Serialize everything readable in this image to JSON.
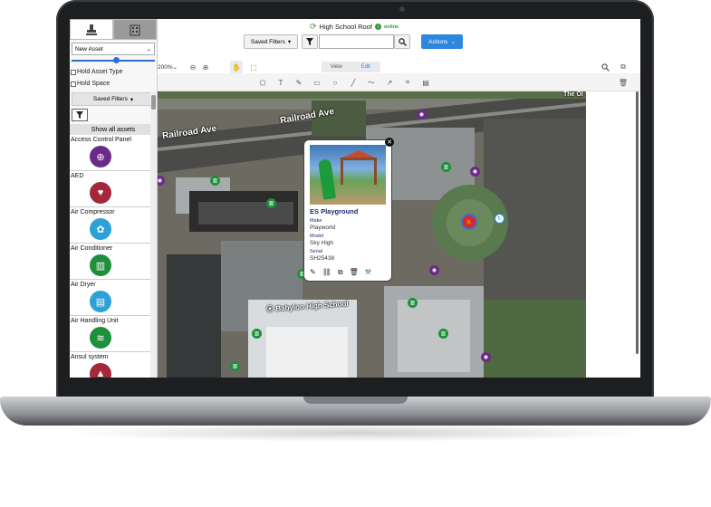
{
  "header": {
    "site_name": "High School Roof",
    "status": "online",
    "saved_filters_label": "Saved Filters",
    "actions_label": "Actions",
    "search_value": ""
  },
  "left_panel": {
    "new_asset_select": "New Asset",
    "hold_asset_type_label": "Hold Asset Type",
    "hold_space_label": "Hold Space",
    "saved_filters_label": "Saved Filters",
    "show_all_label": "Show all assets",
    "assets": [
      {
        "label": "Access Control Panel",
        "icon": "access-control-icon",
        "color": "#6b2a8a",
        "glyph": "⊕"
      },
      {
        "label": "AED",
        "icon": "aed-heart-icon",
        "color": "#a4283a",
        "glyph": "♥"
      },
      {
        "label": "Air Compressor",
        "icon": "air-compressor-icon",
        "color": "#2ea0d8",
        "glyph": "✿"
      },
      {
        "label": "Air Conditioner",
        "icon": "air-conditioner-icon",
        "color": "#1e8f3b",
        "glyph": "▥"
      },
      {
        "label": "Air Dryer",
        "icon": "air-dryer-icon",
        "color": "#2ea0d8",
        "glyph": "▤"
      },
      {
        "label": "Air Handling Unit",
        "icon": "air-handling-unit-icon",
        "color": "#1e8f3b",
        "glyph": "≋"
      },
      {
        "label": "Ansul system",
        "icon": "ansul-system-icon",
        "color": "#a4283a",
        "glyph": "▲"
      }
    ]
  },
  "toolbar": {
    "zoom": "200%",
    "view_label": "View",
    "edit_label": "Edit"
  },
  "map": {
    "road_1": "Railroad Ave",
    "road_2": "Railroad Ave",
    "school_label": "Babylon High School",
    "corner_label": "The Ol"
  },
  "popup": {
    "title": "ES Playground",
    "fields": [
      {
        "key": "Make",
        "value": "Playworld"
      },
      {
        "key": "Model",
        "value": "Sky High"
      },
      {
        "key": "Serial",
        "value": "SH25438"
      }
    ]
  }
}
